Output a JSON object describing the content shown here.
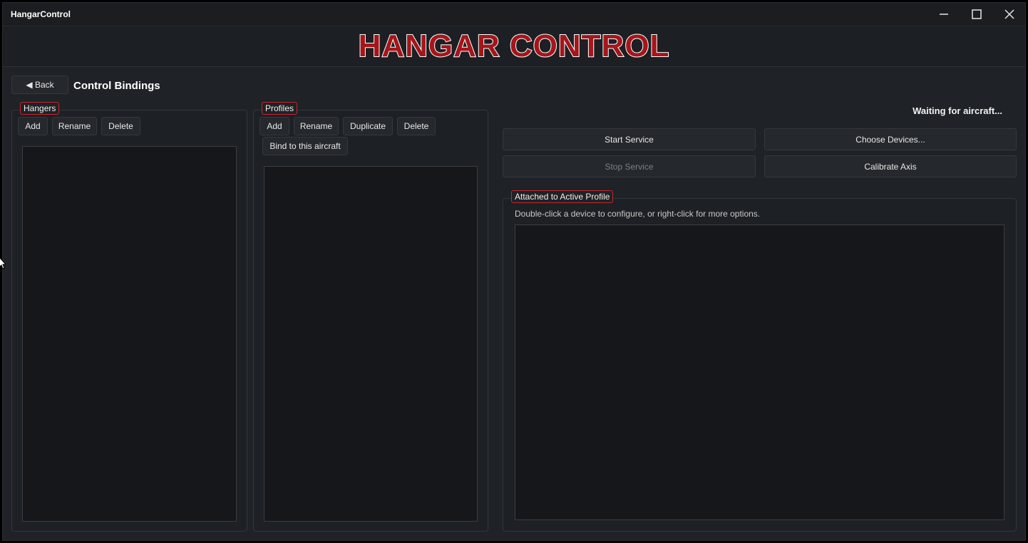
{
  "window": {
    "title": "HangarControl",
    "controls": [
      "minimize-icon",
      "maximize-icon",
      "close-icon"
    ]
  },
  "banner": {
    "logo_text": "HANGAR CONTROL",
    "logo_fill": "#a3161a",
    "logo_outline": "#ffffff"
  },
  "header": {
    "back_label": "◀ Back",
    "page_title": "Control Bindings"
  },
  "hangers": {
    "legend": "Hangers",
    "buttons": {
      "add": "Add",
      "rename": "Rename",
      "delete": "Delete"
    },
    "items": []
  },
  "profiles": {
    "legend": "Profiles",
    "buttons": {
      "add": "Add",
      "rename": "Rename",
      "duplicate": "Duplicate",
      "delete": "Delete",
      "bind": "Bind to this aircraft"
    },
    "items": []
  },
  "service": {
    "status": "Waiting for aircraft...",
    "start_label": "Start Service",
    "stop_label": "Stop Service",
    "choose_devices_label": "Choose Devices...",
    "calibrate_label": "Calibrate Axis"
  },
  "attached": {
    "legend": "Attached to Active Profile",
    "hint": "Double-click a device to configure, or right-click for more options.",
    "devices": []
  },
  "colors": {
    "accent": "#c8262b",
    "background": "#1f2226",
    "list_background": "#15171a"
  }
}
